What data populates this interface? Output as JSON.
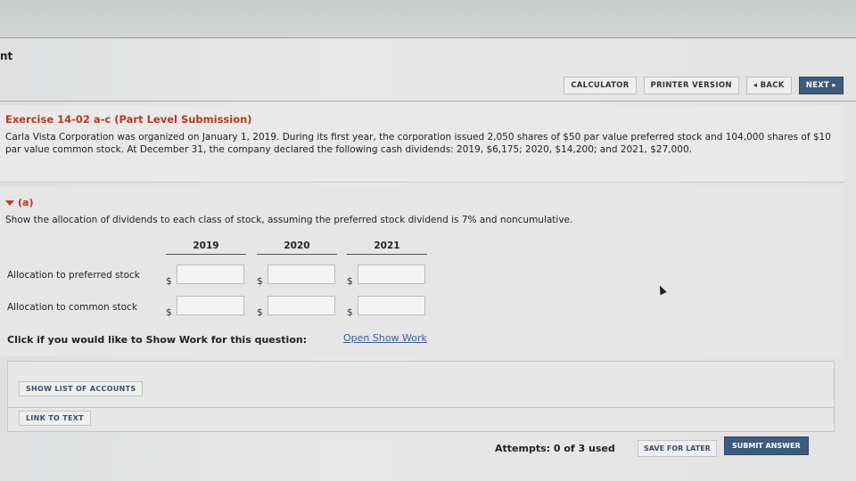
{
  "site": {
    "title_fragment": "nt"
  },
  "nav": {
    "calculator": "CALCULATOR",
    "printer": "PRINTER VERSION",
    "back": "◂ BACK",
    "next": "NEXT ▸"
  },
  "exercise": {
    "title": "Exercise 14-02 a-c (Part Level Submission)",
    "text": "Carla Vista Corporation was organized on January 1, 2019. During its first year, the corporation issued 2,050 shares of $50 par value preferred stock and 104,000 shares of $10 par value common stock. At December 31, the company declared the following cash dividends: 2019, $6,175; 2020, $14,200; and 2021, $27,000."
  },
  "part_a": {
    "label": "(a)",
    "question": "Show the allocation of dividends to each class of stock, assuming the preferred stock dividend is 7% and noncumulative.",
    "columns": [
      "2019",
      "2020",
      "2021"
    ],
    "rows": [
      {
        "label": "Allocation to preferred stock",
        "values": [
          "",
          "",
          ""
        ]
      },
      {
        "label": "Allocation to common stock",
        "values": [
          "",
          "",
          ""
        ]
      }
    ],
    "currency": "$"
  },
  "show_work": {
    "prompt": "Click if you would like to Show Work for this question:",
    "link": "Open Show Work"
  },
  "buttons": {
    "show_accounts": "SHOW LIST OF ACCOUNTS",
    "link_text": "LINK TO TEXT",
    "save_later": "SAVE FOR LATER",
    "submit": "SUBMIT ANSWER"
  },
  "attempts": "Attempts: 0 of 3 used"
}
